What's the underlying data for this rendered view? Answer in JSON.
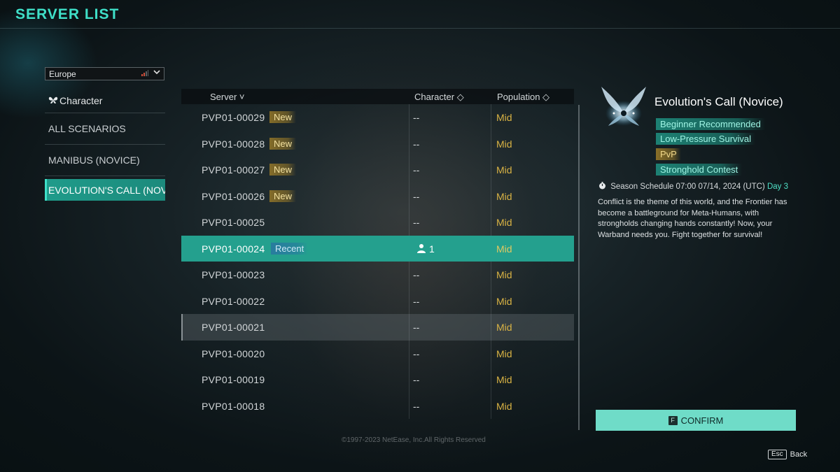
{
  "header": {
    "title": "SERVER LIST"
  },
  "region": {
    "value": "Europe",
    "signal_icon": "signal-bars-icon",
    "chevron_icon": "chevron-down-icon"
  },
  "nav": {
    "character_label": "Character",
    "items": [
      {
        "label": "ALL SCENARIOS"
      },
      {
        "label": "MANIBUS (NOVICE)"
      },
      {
        "label": "EVOLUTION'S CALL (NOVI"
      }
    ]
  },
  "table": {
    "headers": {
      "server": "Server ˅",
      "character": "Character ◇",
      "population": "Population ◇"
    },
    "rows": [
      {
        "server": "PVP01-00029",
        "badge": "New",
        "character": "--",
        "population": "Mid"
      },
      {
        "server": "PVP01-00028",
        "badge": "New",
        "character": "--",
        "population": "Mid"
      },
      {
        "server": "PVP01-00027",
        "badge": "New",
        "character": "--",
        "population": "Mid"
      },
      {
        "server": "PVP01-00026",
        "badge": "New",
        "character": "--",
        "population": "Mid"
      },
      {
        "server": "PVP01-00025",
        "badge": "",
        "character": "--",
        "population": "Mid"
      },
      {
        "server": "PVP01-00024",
        "badge": "Recent",
        "character": "1",
        "population": "Mid"
      },
      {
        "server": "PVP01-00023",
        "badge": "",
        "character": "--",
        "population": "Mid"
      },
      {
        "server": "PVP01-00022",
        "badge": "",
        "character": "--",
        "population": "Mid"
      },
      {
        "server": "PVP01-00021",
        "badge": "",
        "character": "--",
        "population": "Mid"
      },
      {
        "server": "PVP01-00020",
        "badge": "",
        "character": "--",
        "population": "Mid"
      },
      {
        "server": "PVP01-00019",
        "badge": "",
        "character": "--",
        "population": "Mid"
      },
      {
        "server": "PVP01-00018",
        "badge": "",
        "character": "--",
        "population": "Mid"
      }
    ]
  },
  "details": {
    "title": "Evolution's Call (Novice)",
    "tags": [
      "Beginner Recommended",
      "Low-Pressure Survival",
      "PvP",
      "Stronghold Contest"
    ],
    "season_text": "Season Schedule 07:00 07/14, 2024 (UTC)",
    "season_day": "Day 3",
    "description": "Conflict is the theme of this world, and the Frontier has become a battleground for Meta-Humans, with strongholds changing hands constantly! Now, your Warband needs you. Fight together for survival!"
  },
  "confirm": {
    "key": "F",
    "label": "CONFIRM"
  },
  "footer": {
    "copyright": "©1997-2023 NetEase, Inc.All Rights Reserved",
    "esc_key": "Esc",
    "back_label": "Back"
  },
  "colors": {
    "accent": "#3fe0c8",
    "selected_row": "#24a08e",
    "population": "#d9b344",
    "confirm_bg": "#6fdcc8"
  }
}
